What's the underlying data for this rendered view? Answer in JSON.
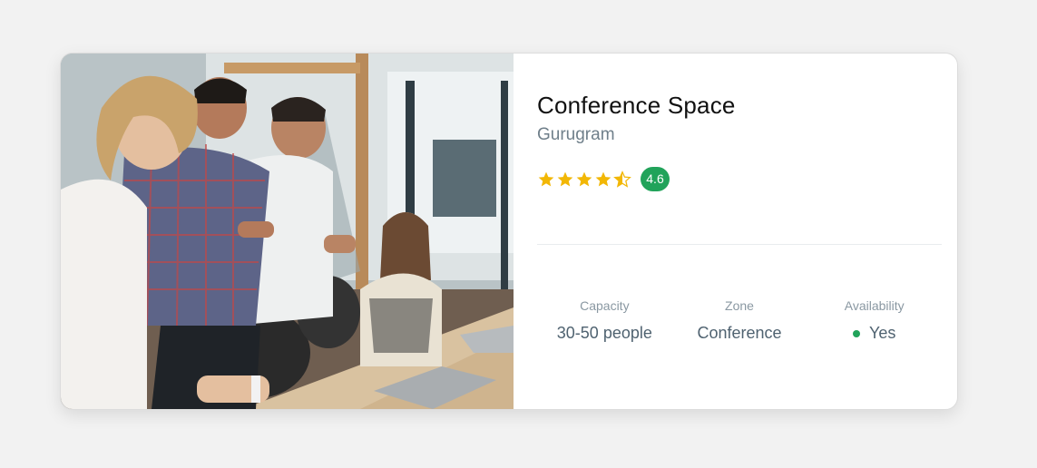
{
  "space": {
    "title": "Conference Space",
    "location": "Gurugram",
    "rating": {
      "value": "4.6",
      "stars": 4.5,
      "star_color": "#f2b705",
      "badge_color": "#21a35a"
    }
  },
  "photo": {
    "description_icon": "photo-image"
  },
  "stats": [
    {
      "label": "Capacity",
      "value": "30-50 people"
    },
    {
      "label": "Zone",
      "value": "Conference"
    },
    {
      "label": "Availability",
      "value": "Yes",
      "indicator_color": "#21a35a"
    }
  ]
}
